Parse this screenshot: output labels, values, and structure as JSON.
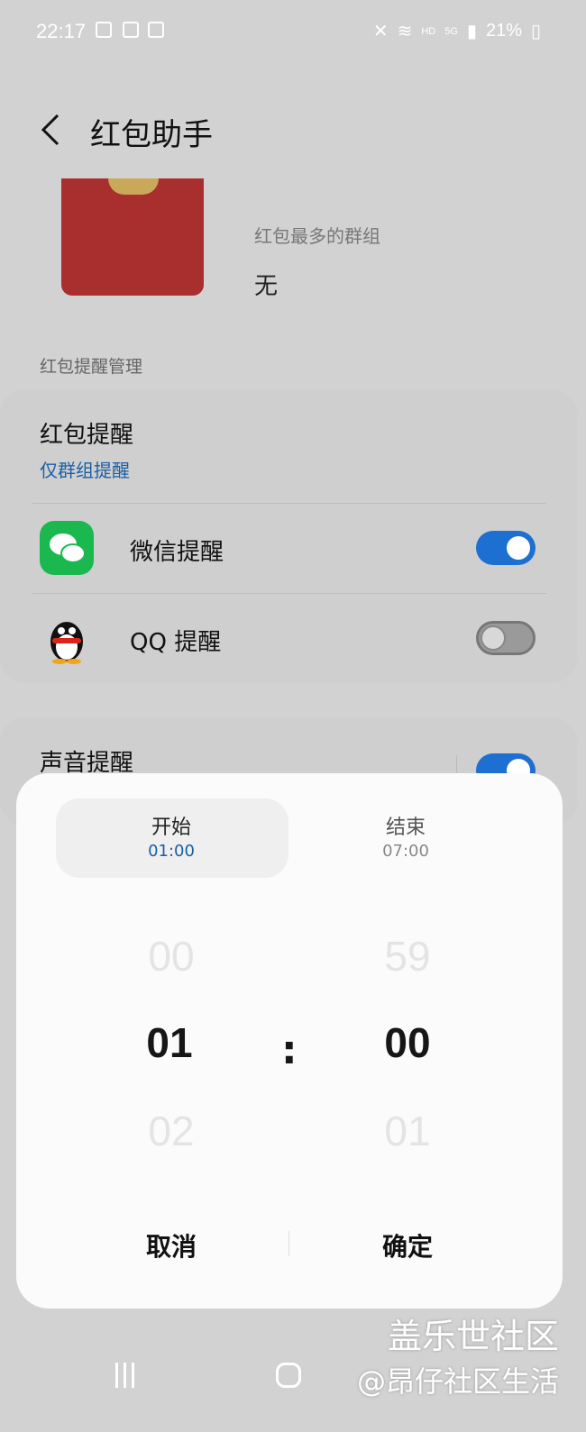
{
  "status_bar": {
    "time": "22:17",
    "battery": "21%",
    "network": "5G",
    "hd": "HD"
  },
  "header": {
    "title": "红包助手"
  },
  "top_card": {
    "group_label": "红包最多的群组",
    "group_value": "无"
  },
  "section_label": "红包提醒管理",
  "reminder_card": {
    "title": "红包提醒",
    "subtitle": "仅群组提醒",
    "rows": [
      {
        "label": "微信提醒",
        "enabled": true,
        "icon": "wechat-icon"
      },
      {
        "label": "QQ 提醒",
        "enabled": false,
        "icon": "qq-icon"
      }
    ]
  },
  "sound_card": {
    "title": "声音提醒",
    "enabled": true
  },
  "time_dialog": {
    "tabs": [
      {
        "label": "开始",
        "time": "01:00",
        "selected": true
      },
      {
        "label": "结束",
        "time": "07:00",
        "selected": false
      }
    ],
    "hours": {
      "prev": "00",
      "current": "01",
      "next": "02"
    },
    "minutes": {
      "prev": "59",
      "current": "00",
      "next": "01"
    },
    "separator": ":",
    "cancel_label": "取消",
    "confirm_label": "确定"
  },
  "watermark": {
    "line1": "盖乐世社区",
    "line2": "@昂仔社区生活"
  },
  "colors": {
    "accent": "#1d6fd1",
    "link": "#1a5fa6",
    "envelope": "#a92f2e",
    "wechat": "#1ab84f"
  }
}
